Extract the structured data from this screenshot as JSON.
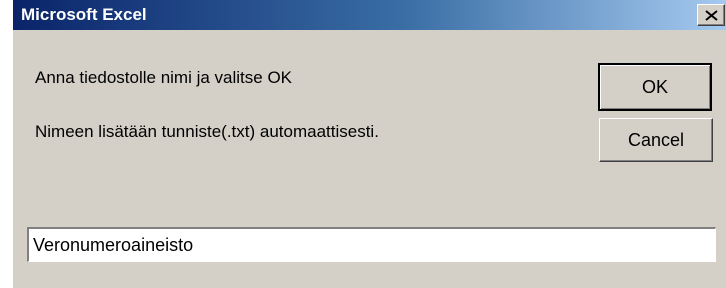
{
  "window": {
    "title": "Microsoft Excel",
    "close_glyph": "close-icon"
  },
  "dialog": {
    "prompt_line1": "Anna tiedostolle nimi ja valitse OK",
    "prompt_line2": "Nimeen lisätään tunniste(.txt) automaattisesti.",
    "ok_label": "OK",
    "cancel_label": "Cancel",
    "input_value": "Veronumeroaineisto"
  },
  "colors": {
    "titlebar_start": "#0a246a",
    "titlebar_end": "#a6caf0",
    "dialog_background": "#d4d0c8"
  }
}
